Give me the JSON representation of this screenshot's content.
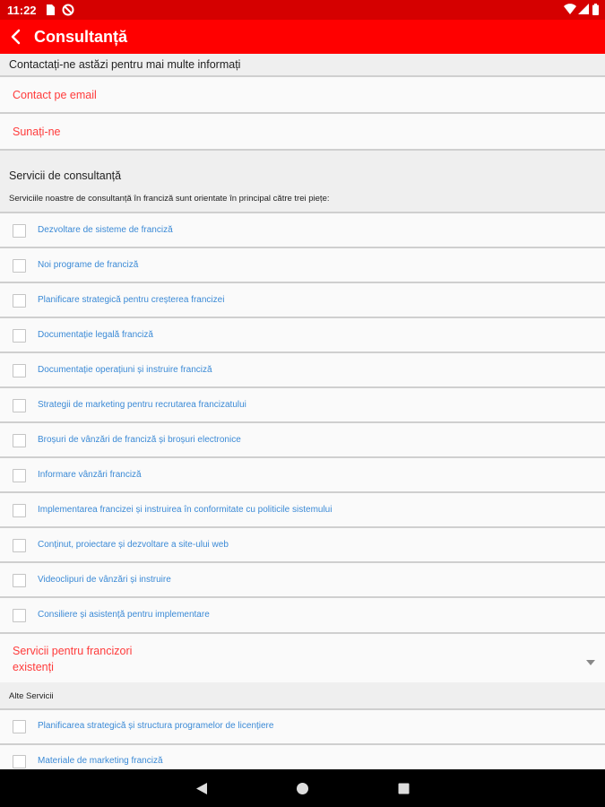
{
  "status_bar": {
    "time": "11:22",
    "icons": [
      "sd-card-icon",
      "blocked-icon",
      "wifi-icon",
      "signal-icon",
      "battery-icon"
    ]
  },
  "app_bar": {
    "title": "Consultanță",
    "back_icon": "back-arrow-icon",
    "background": "#ff0000"
  },
  "contact": {
    "heading": "Contactați-ne astăzi pentru mai multe informați",
    "email_label": "Contact pe email",
    "call_label": "Sunați-ne"
  },
  "services": {
    "heading": "Servicii de consultanță",
    "description": "Serviciile noastre de consultanță în franciză sunt orientate în principal către trei piețe:",
    "items": [
      {
        "label": "Dezvoltare de sisteme de franciză",
        "checked": false
      },
      {
        "label": "Noi programe de franciză",
        "checked": false
      },
      {
        "label": "Planificare strategică pentru creșterea francizei",
        "checked": false
      },
      {
        "label": "Documentație legală franciză",
        "checked": false
      },
      {
        "label": "Documentație operațiuni și instruire franciză",
        "checked": false
      },
      {
        "label": "Strategii de marketing pentru recrutarea francizatului",
        "checked": false
      },
      {
        "label": "Broșuri de vânzări de franciză și broșuri electronice",
        "checked": false
      },
      {
        "label": "Informare vânzări franciză",
        "checked": false
      },
      {
        "label": "Implementarea francizei și instruirea în conformitate cu politicile sistemului",
        "checked": false
      },
      {
        "label": "Conținut, proiectare și dezvoltare a site-ului web",
        "checked": false
      },
      {
        "label": "Videoclipuri de vânzări și instruire",
        "checked": false
      },
      {
        "label": "Consiliere și asistență pentru implementare",
        "checked": false
      }
    ]
  },
  "existing": {
    "line1": "Servicii pentru francizori",
    "line2": "existenți",
    "icon": "dropdown-arrow-icon"
  },
  "other": {
    "heading": "Alte Servicii",
    "items": [
      {
        "label": "Planificarea strategică și structura programelor de licențiere",
        "checked": false
      },
      {
        "label": "Materiale de marketing franciză",
        "checked": false
      }
    ]
  },
  "colors": {
    "accent_red": "#ff3b3b",
    "link_blue": "#3b8ad6"
  }
}
